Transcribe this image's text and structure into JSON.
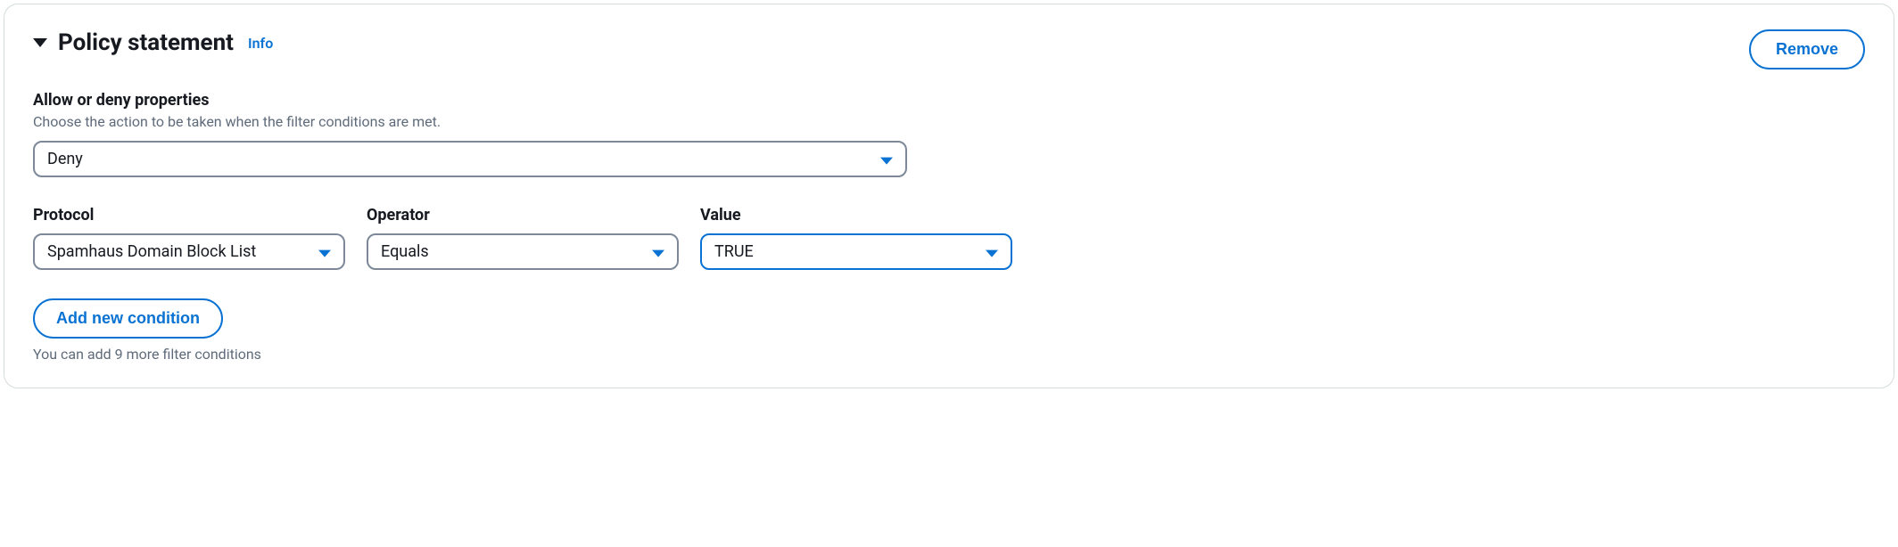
{
  "header": {
    "title": "Policy statement",
    "info_label": "Info",
    "remove_label": "Remove"
  },
  "action_section": {
    "label": "Allow or deny properties",
    "description": "Choose the action to be taken when the filter conditions are met.",
    "selected": "Deny"
  },
  "conditions": {
    "protocol": {
      "label": "Protocol",
      "selected": "Spamhaus Domain Block List"
    },
    "operator": {
      "label": "Operator",
      "selected": "Equals"
    },
    "value": {
      "label": "Value",
      "selected": "TRUE"
    }
  },
  "footer": {
    "add_button_label": "Add new condition",
    "hint": "You can add 9 more filter conditions"
  }
}
